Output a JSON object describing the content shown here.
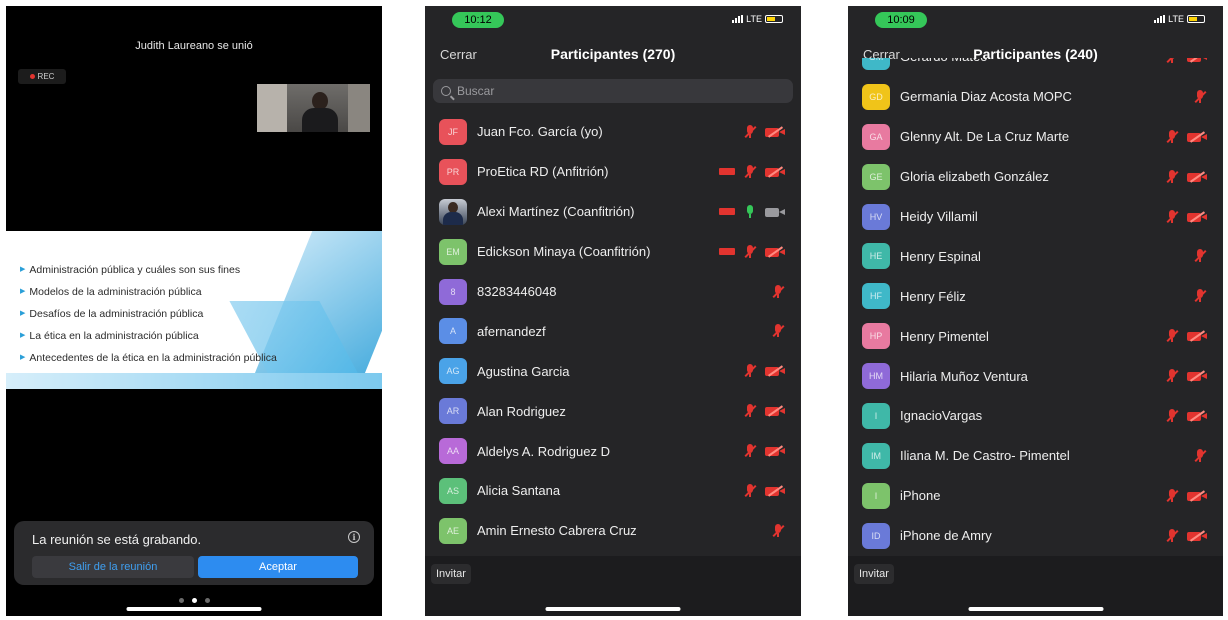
{
  "screen1": {
    "joined_message": "Judith Laureano se unió",
    "rec_badge": "REC",
    "slide_bullets": [
      "Administración pública y cuáles son sus fines",
      "Modelos de la administración pública",
      "Desafíos de la administración pública",
      "La ética en la administración pública",
      "Antecedentes de la ética en la administración pública"
    ],
    "recording_dialog": {
      "message": "La reunión se está grabando.",
      "info_glyph": "i",
      "leave_button": "Salir de la reunión",
      "accept_button": "Aceptar"
    }
  },
  "screen2": {
    "time": "10:12",
    "network": "LTE",
    "close_label": "Cerrar",
    "title": "Participantes (270)",
    "search_placeholder": "Buscar",
    "invite_label": "Invitar",
    "participants": [
      {
        "initials": "JF",
        "name": "Juan Fco. García  (yo)",
        "color": "#e8525a",
        "rec": false,
        "mic": "off",
        "cam": "off"
      },
      {
        "initials": "PR",
        "name": "ProEtica RD (Anfitrión)",
        "color": "#e8525a",
        "rec": true,
        "mic": "off",
        "cam": "off"
      },
      {
        "initials": "",
        "name": "Alexi Martínez (Coanfitrión)",
        "color": "photo",
        "rec": true,
        "mic": "on",
        "cam": "on"
      },
      {
        "initials": "EM",
        "name": "Edickson Minaya (Coanfitrión)",
        "color": "#7dc36b",
        "rec": true,
        "mic": "off",
        "cam": "off"
      },
      {
        "initials": "8",
        "name": "83283446048",
        "color": "#8f6ad8",
        "rec": false,
        "mic": "off",
        "cam": "none"
      },
      {
        "initials": "A",
        "name": "afernandezf",
        "color": "#5b8ee6",
        "rec": false,
        "mic": "off",
        "cam": "none"
      },
      {
        "initials": "AG",
        "name": "Agustina Garcia",
        "color": "#4aa3e8",
        "rec": false,
        "mic": "off",
        "cam": "off"
      },
      {
        "initials": "AR",
        "name": "Alan Rodriguez",
        "color": "#6a7ad8",
        "rec": false,
        "mic": "off",
        "cam": "off"
      },
      {
        "initials": "AA",
        "name": "Aldelys A. Rodriguez D",
        "color": "#b86ad8",
        "rec": false,
        "mic": "off",
        "cam": "off"
      },
      {
        "initials": "AS",
        "name": "Alicia Santana",
        "color": "#5cc07a",
        "rec": false,
        "mic": "off",
        "cam": "off"
      },
      {
        "initials": "AE",
        "name": "Amin Ernesto Cabrera Cruz",
        "color": "#7dc36b",
        "rec": false,
        "mic": "off",
        "cam": "none"
      }
    ]
  },
  "screen3": {
    "time": "10:09",
    "network": "LTE",
    "close_label": "Cerrar",
    "title": "Participantes (240)",
    "invite_label": "Invitar",
    "participants": [
      {
        "initials": "GM",
        "name": "Gerardo Mateo",
        "color": "#3fb8c8",
        "rec": false,
        "mic": "off",
        "cam": "off"
      },
      {
        "initials": "GD",
        "name": "Germania Diaz Acosta MOPC",
        "color": "#f0c419",
        "rec": false,
        "mic": "off",
        "cam": "none"
      },
      {
        "initials": "GA",
        "name": "Glenny Alt. De La Cruz Marte",
        "color": "#e87aa0",
        "rec": false,
        "mic": "off",
        "cam": "off"
      },
      {
        "initials": "GE",
        "name": "Gloria elizabeth González",
        "color": "#7dc36b",
        "rec": false,
        "mic": "off",
        "cam": "off"
      },
      {
        "initials": "HV",
        "name": "Heidy Villamil",
        "color": "#6a7ad8",
        "rec": false,
        "mic": "off",
        "cam": "off"
      },
      {
        "initials": "HE",
        "name": "Henry Espinal",
        "color": "#3fb8a8",
        "rec": false,
        "mic": "off",
        "cam": "none"
      },
      {
        "initials": "HF",
        "name": "Henry Féliz",
        "color": "#3fb8c8",
        "rec": false,
        "mic": "off",
        "cam": "none"
      },
      {
        "initials": "HP",
        "name": "Henry Pimentel",
        "color": "#e87aa0",
        "rec": false,
        "mic": "off",
        "cam": "off"
      },
      {
        "initials": "HM",
        "name": "Hilaria Muñoz Ventura",
        "color": "#8f6ad8",
        "rec": false,
        "mic": "off",
        "cam": "off"
      },
      {
        "initials": "I",
        "name": "IgnacioVargas",
        "color": "#3fb8a8",
        "rec": false,
        "mic": "off",
        "cam": "off"
      },
      {
        "initials": "IM",
        "name": "Iliana M. De Castro- Pimentel",
        "color": "#3fb8a8",
        "rec": false,
        "mic": "off",
        "cam": "none"
      },
      {
        "initials": "I",
        "name": "iPhone",
        "color": "#7dc36b",
        "rec": false,
        "mic": "off",
        "cam": "off"
      },
      {
        "initials": "ID",
        "name": "iPhone de Amry",
        "color": "#6a7ad8",
        "rec": false,
        "mic": "off",
        "cam": "off"
      }
    ]
  }
}
